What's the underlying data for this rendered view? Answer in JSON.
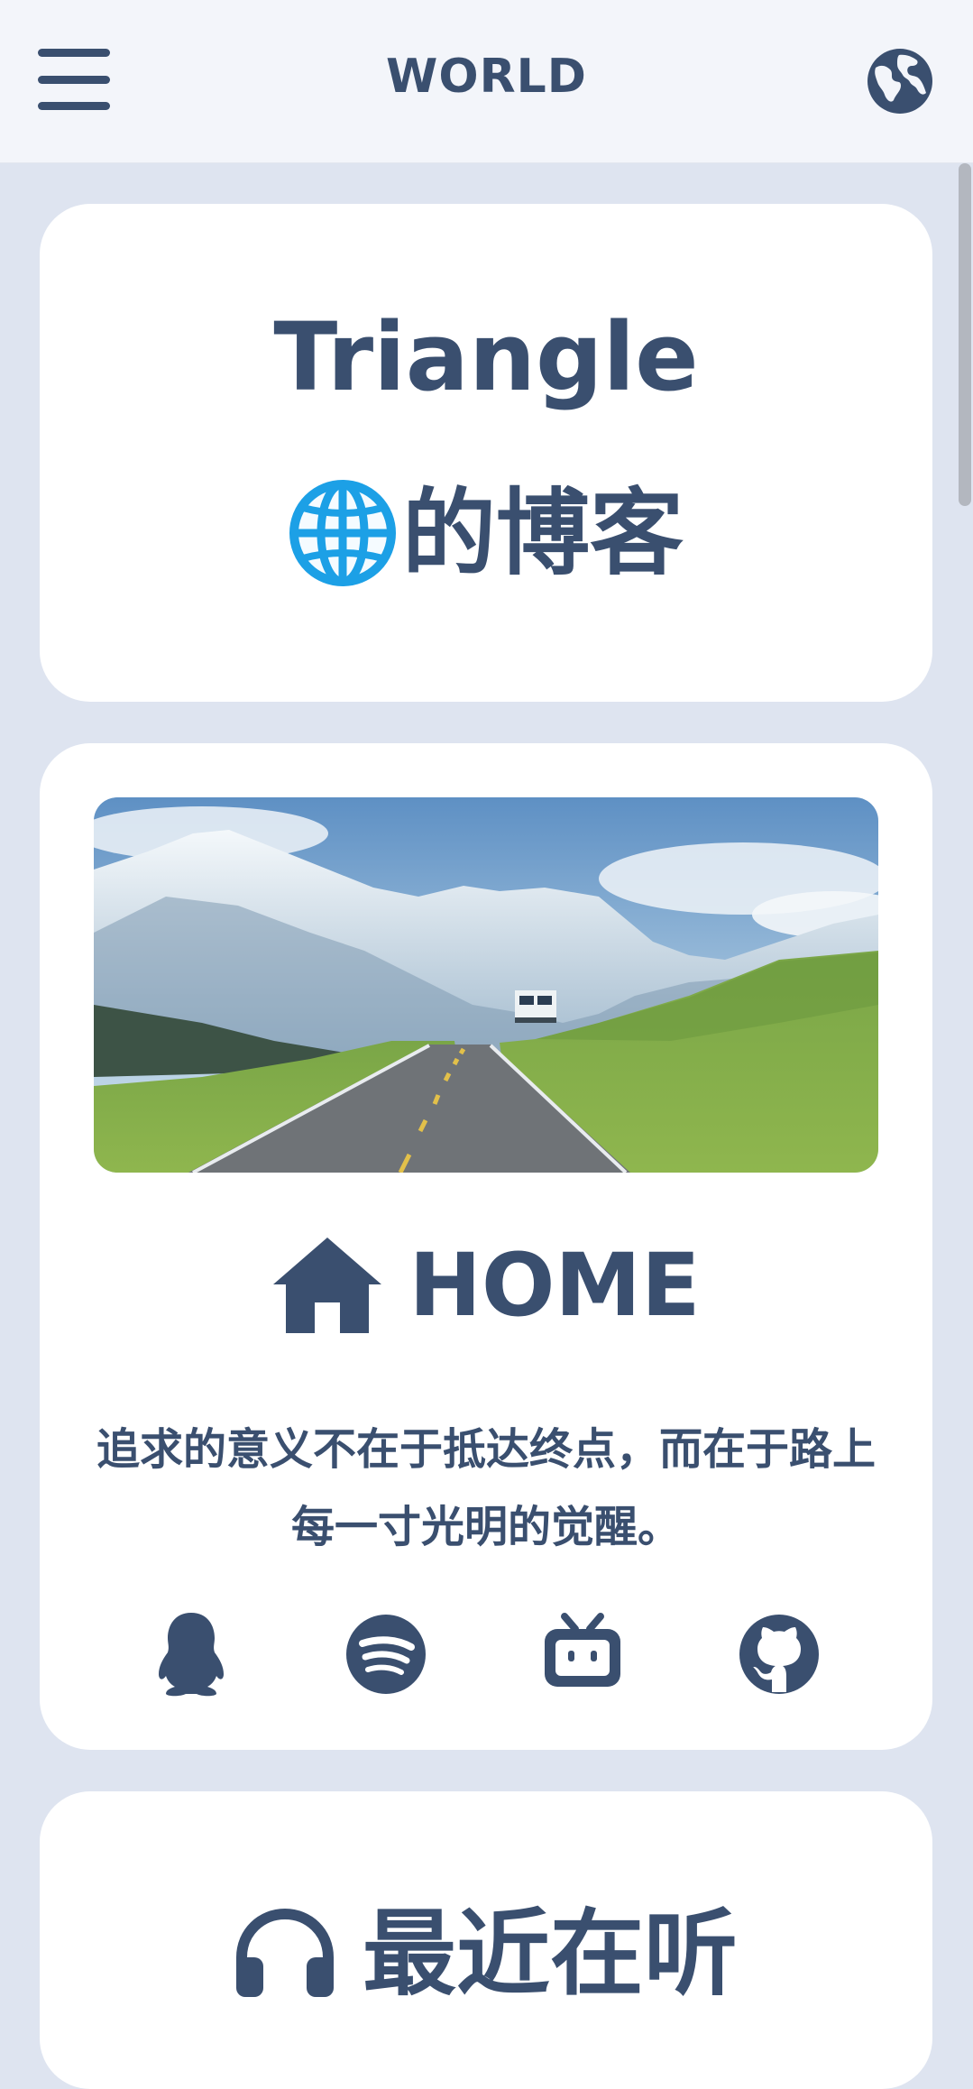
{
  "header": {
    "brand": "WORLD",
    "menu_icon": "hamburger-menu-icon",
    "globe_icon": "globe-icon"
  },
  "intro_card": {
    "title_en": "Triangle",
    "title_cn": "的博客",
    "emoji_icon": "globe-emoji-icon"
  },
  "home_card": {
    "hero_image": "mountain-road-with-bus-photo",
    "title": "HOME",
    "title_icon": "house-icon",
    "motto": "追求的意义不在于抵达终点，而在于路上每一寸光明的觉醒。",
    "social_links": [
      {
        "name": "qq",
        "icon": "qq-penguin-icon"
      },
      {
        "name": "spotify",
        "icon": "spotify-icon"
      },
      {
        "name": "bilibili",
        "icon": "bilibili-icon"
      },
      {
        "name": "github",
        "icon": "github-icon"
      }
    ]
  },
  "music_card": {
    "title": "最近在听",
    "title_icon": "headphones-icon"
  },
  "colors": {
    "text": "#3a4f6f",
    "background": "#dee4f0",
    "card": "#ffffff",
    "header": "#f3f5fa"
  }
}
